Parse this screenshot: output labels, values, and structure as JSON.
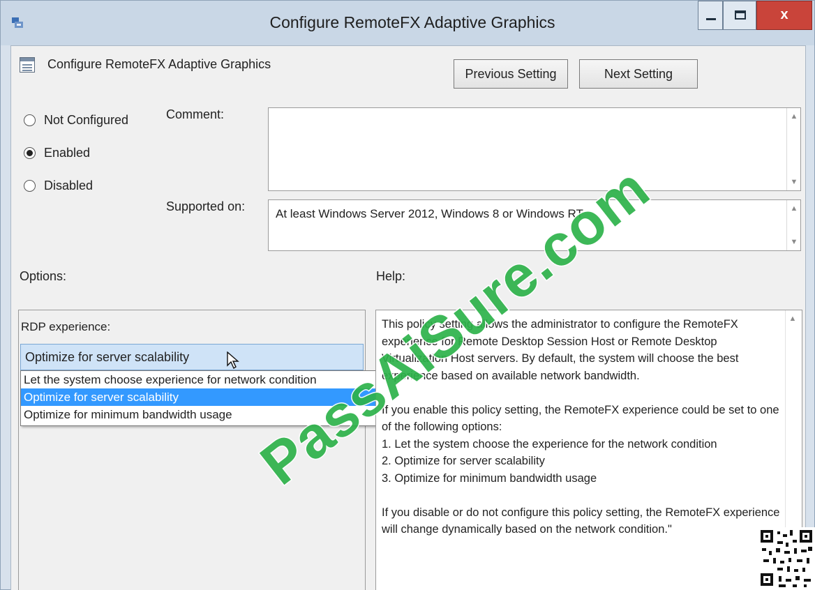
{
  "window": {
    "title": "Configure RemoteFX Adaptive Graphics",
    "close_glyph": "x",
    "colors": {
      "close": "#c9443a",
      "selection": "#3399ff",
      "watermark": "#2db24a"
    }
  },
  "policy": {
    "name": "Configure RemoteFX Adaptive Graphics"
  },
  "buttons": {
    "previous": "Previous Setting",
    "next": "Next Setting"
  },
  "state": {
    "not_configured": "Not Configured",
    "enabled": "Enabled",
    "disabled": "Disabled",
    "selected": "Enabled"
  },
  "labels": {
    "comment": "Comment:",
    "supported_on": "Supported on:",
    "options": "Options:",
    "help": "Help:"
  },
  "comment": {
    "value": ""
  },
  "supported_on": {
    "value": "At least Windows Server 2012, Windows 8 or Windows RT"
  },
  "options": {
    "rdp_label": "RDP experience:",
    "selected": "Optimize for server scalability",
    "dropdown": [
      "Let the system choose experience for network condition",
      "Optimize for server scalability",
      "Optimize for minimum bandwidth usage"
    ],
    "highlighted_index": 1
  },
  "help": {
    "paragraphs": [
      "This policy setting allows the administrator to configure the RemoteFX experience for Remote Desktop Session Host or Remote Desktop Virtualization Host servers. By default, the system will choose the best experience based on available network bandwidth.",
      "If you enable this policy setting, the RemoteFX experience could be set to one of the following options:\n1. Let the system choose the experience for the network condition\n2. Optimize for server scalability\n3. Optimize for minimum bandwidth usage",
      "If you disable or do not configure this policy setting, the RemoteFX experience will change dynamically based on the network condition.\""
    ]
  },
  "watermark": {
    "text": "PassAiSure.com"
  },
  "icons": {
    "app": "group-policy-icon",
    "policy": "policy-setting-icon",
    "cursor": "mouse-pointer-icon",
    "qr": "qr-code"
  }
}
